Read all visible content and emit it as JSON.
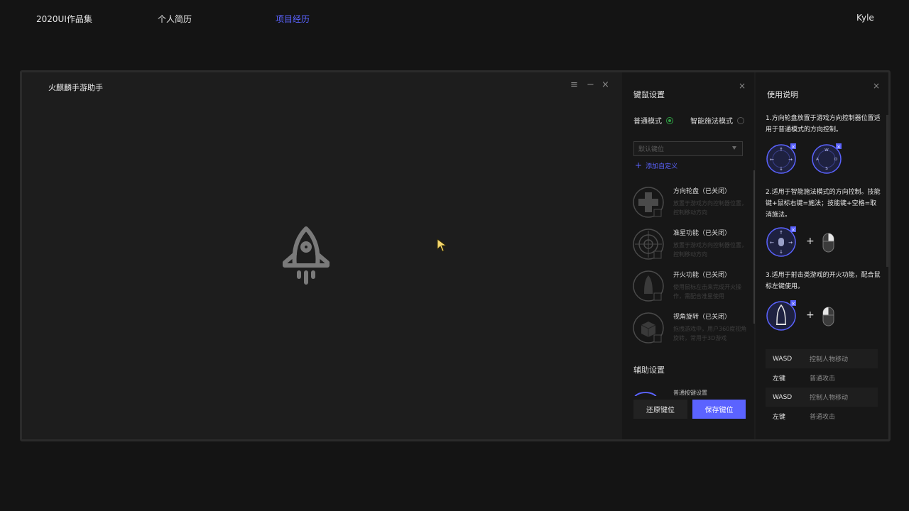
{
  "nav": {
    "portfolio": "2020UI作品集",
    "resume": "个人简历",
    "projects": "项目经历",
    "user": "Kyle"
  },
  "colors": {
    "accent": "#5b63ff",
    "radio_on": "#2ea043",
    "background": "#141414"
  },
  "window": {
    "title": "火麒麟手游助手",
    "menu_icon": "≡",
    "minimize_icon": "−",
    "close_icon": "×"
  },
  "keys_panel": {
    "title": "键鼠设置",
    "close": "×",
    "mode_normal": "普通模式",
    "mode_smart": "智能施法模式",
    "mode_selected": "普通模式",
    "select_placeholder": "默认键位",
    "add_custom": "添加自定义",
    "add_icon": "+",
    "features": [
      {
        "title": "方向轮盘（已关闭）",
        "desc": "放置于游戏方向控制器位置，控制移动方向",
        "icon": "dpad-icon"
      },
      {
        "title": "准星功能（已关闭）",
        "desc": "放置于游戏方向控制器位置，控制移动方向",
        "icon": "crosshair-icon"
      },
      {
        "title": "开火功能（已关闭）",
        "desc": "使用鼠标左击来完成开火操作，需配合准星使用",
        "icon": "bullet-icon"
      },
      {
        "title": "视角旋转（已关闭）",
        "desc": "拖拽游戏中，用户360度视角旋转，常用于3D游戏",
        "icon": "cube-icon"
      }
    ],
    "aux_title": "辅助设置",
    "aux_peek": "普通按键设置",
    "reset_button": "还原键位",
    "save_button": "保存键位"
  },
  "help_panel": {
    "title": "使用说明",
    "close": "×",
    "step1": "1.方向轮盘放置于游戏方向控制器位置适用于普通模式的方向控制。",
    "step2": "2.适用于智能施法模式的方向控制。技能键+鼠标右键=施法；技能键+空格=取消施法。",
    "step3": "3.适用于射击类游戏的开火功能，配合鼠标左键使用。",
    "plus": "+",
    "wasd_letters": [
      "W",
      "A",
      "S",
      "D"
    ],
    "key_rows": [
      {
        "key": "WASD",
        "action": "控制人物移动"
      },
      {
        "key": "左键",
        "action": "普通攻击"
      },
      {
        "key": "WASD",
        "action": "控制人物移动"
      },
      {
        "key": "左键",
        "action": "普通攻击"
      }
    ]
  }
}
